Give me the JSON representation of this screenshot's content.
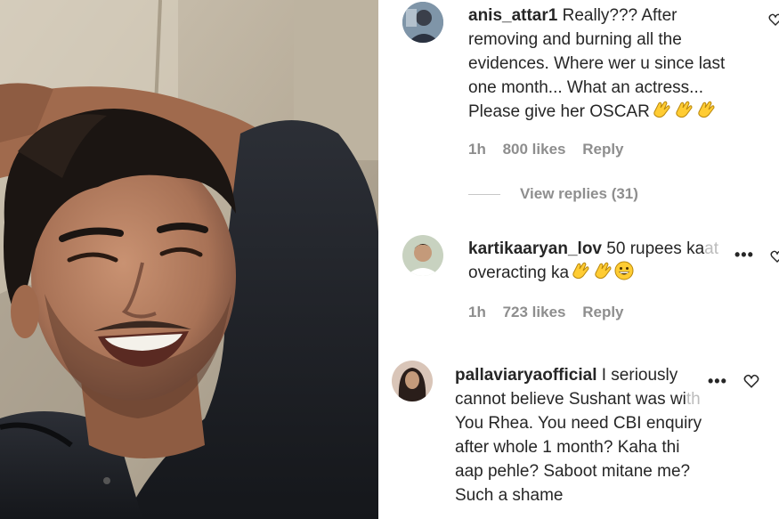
{
  "image_alt": "Smiling man with curly dark hair lying back with arm behind head",
  "colors": {
    "text": "#262626",
    "meta": "#8e8e8e",
    "divider": "#c7c7c7",
    "emoji": "#ffcc33"
  },
  "comments": [
    {
      "username": "anis_attar1",
      "lines": [
        "Really??? After",
        "removing and burning all the",
        "evidences. Where wer u since last",
        "one month... What an actress...",
        "Please give her OSCAR"
      ],
      "emojis": [
        "clapping-hands",
        "clapping-hands",
        "clapping-hands"
      ],
      "time": "1h",
      "likes": "800 likes",
      "reply": "Reply",
      "view_replies": "View replies (31)"
    },
    {
      "username": "kartikaaryan_lov",
      "lines": [
        "50 rupees ka",
        "at",
        "overacting ka"
      ],
      "emojis": [
        "clapping-hands",
        "clapping-hands",
        "grinning-face"
      ],
      "time": "1h",
      "likes": "723 likes",
      "reply": "Reply"
    },
    {
      "username": "pallaviaryaofficial",
      "lines": [
        "I seriously",
        "cannot believe Sushant was wi",
        "th",
        "You Rhea. You need CBI enquiry",
        "after whole 1 month? Kaha thi",
        "aap pehle? Saboot mitane me?",
        "Such a shame"
      ]
    }
  ]
}
